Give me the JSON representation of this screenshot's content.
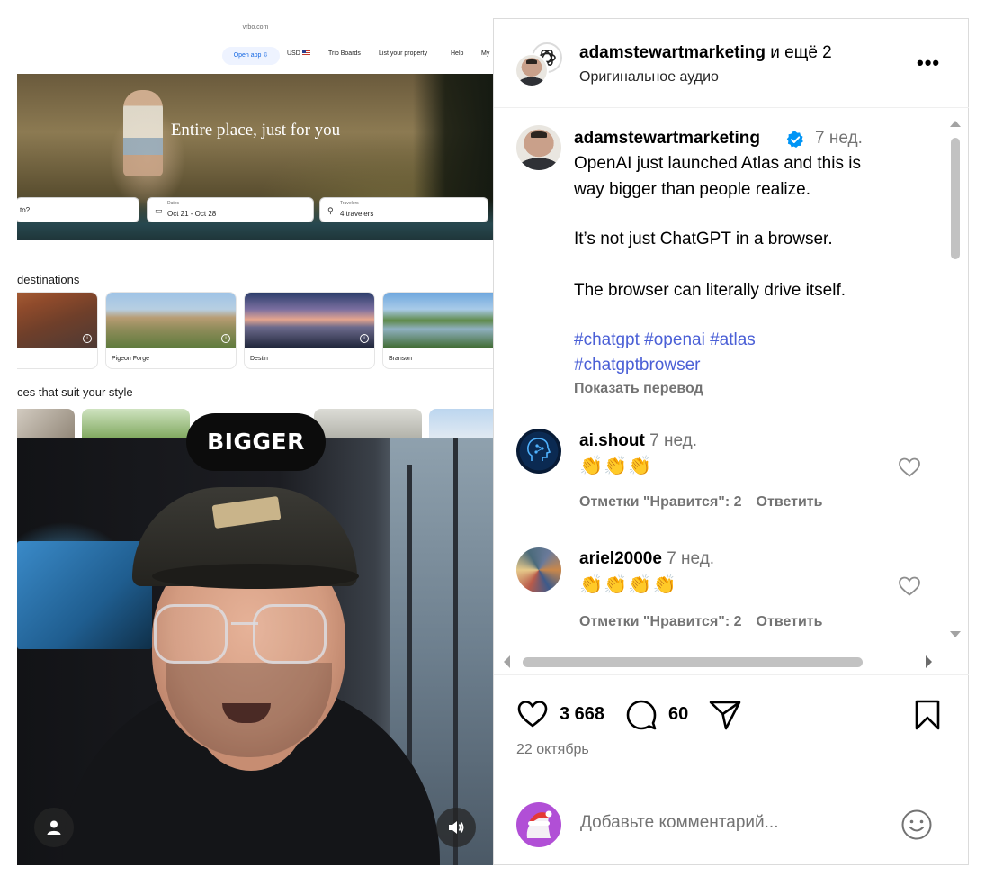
{
  "video": {
    "vrbo": {
      "url": "vrbo.com",
      "nav": {
        "open_app": "Open app",
        "open_app_icon": "download-icon",
        "currency": "USD",
        "trip_boards": "Trip Boards",
        "list_property": "List your property",
        "help": "Help",
        "my": "My"
      },
      "hero_title": "Entire place, just for you",
      "search": {
        "where_value": "to?",
        "dates_label": "Dates",
        "dates_value": "Oct 21 - Oct 28",
        "travelers_label": "Travelers",
        "travelers_value": "4 travelers"
      },
      "destinations_heading": "destinations",
      "destinations": [
        {
          "name": ""
        },
        {
          "name": "Pigeon Forge"
        },
        {
          "name": "Destin"
        },
        {
          "name": "Branson"
        }
      ],
      "style_heading": "ces that suit your style"
    },
    "caption_overlay": "BIGGER",
    "controls": {
      "profile_icon": "person-icon",
      "sound_icon": "speaker-icon"
    }
  },
  "post": {
    "header": {
      "authors": "adamstewartmarketing",
      "authors_more": " и ещё 2",
      "audio": "Оригинальное аудио",
      "menu": "•••"
    },
    "caption": {
      "username": "adamstewartmarketing",
      "time": "7 нед.",
      "lines": [
        "OpenAI just launched Atlas and this is",
        "way bigger than people realize.",
        "It’s not just ChatGPT in a browser.",
        "The browser can literally drive itself."
      ],
      "hashtags_line1": "#chatgpt #openai #atlas",
      "hashtags_line2": "#chatgptbrowser",
      "translate": "Показать перевод"
    },
    "comments": [
      {
        "username": "ai.shout",
        "time": "7 нед.",
        "text": "👏👏👏",
        "likes": "Отметки \"Нравится\": 2",
        "reply": "Ответить"
      },
      {
        "username": "ariel2000e",
        "time": "7 нед.",
        "text": "👏👏👏👏",
        "likes": "Отметки \"Нравится\": 2",
        "reply": "Ответить"
      }
    ],
    "stats": {
      "likes": "3 668",
      "comments": "60",
      "date": "22 октябрь"
    },
    "add_comment_placeholder": "Добавьте комментарий..."
  },
  "colors": {
    "link_blue": "#4a5fd6",
    "verified_blue": "#0095f6",
    "muted": "#737373"
  }
}
